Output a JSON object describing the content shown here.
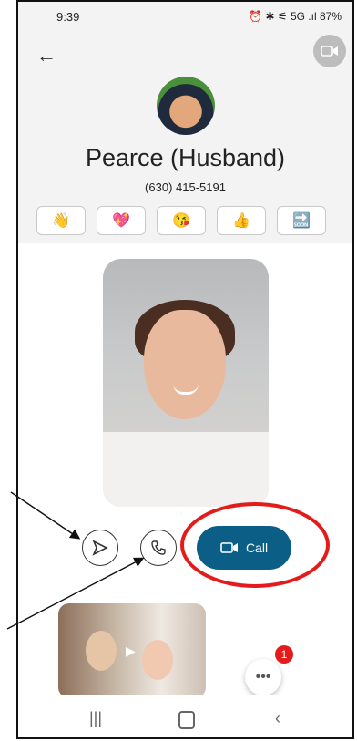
{
  "status_bar": {
    "time": "9:39",
    "right": "⏰ ✱ ⚟ 5G .ıl 87%"
  },
  "contact": {
    "name": "Pearce (Husband)",
    "phone": "(630) 415-5191"
  },
  "reactions": [
    {
      "icon_name": "wave-hand-icon",
      "glyph": "👋"
    },
    {
      "icon_name": "heart-icon",
      "glyph": "💖"
    },
    {
      "icon_name": "kiss-face-icon",
      "glyph": "😘"
    },
    {
      "icon_name": "thumbs-up-icon",
      "glyph": "👍"
    },
    {
      "icon_name": "soon-arrow-icon",
      "glyph": "🔜"
    }
  ],
  "actions": {
    "call_label": "Call"
  },
  "badge": {
    "count": "1"
  },
  "colors": {
    "accent": "#0b5f86",
    "annotation": "#e31b1b"
  }
}
